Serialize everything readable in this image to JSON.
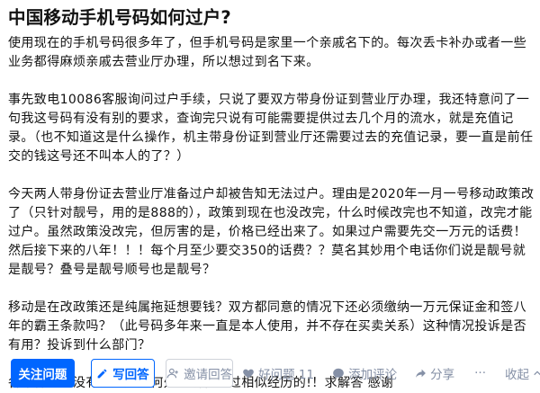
{
  "question": {
    "title": "中国移动手机号码如何过户?",
    "paragraphs": [
      "使用现在的手机号码很多年了，但手机号码是家里一个亲戚名下的。每次丢卡补办或者一些业务都得麻烦亲戚去营业厅办理，所以想过到名下来。",
      "事先致电10086客服询问过户手续，只说了要双方带身份证到营业厅办理，我还特意问了一句我这号码有没有别的要求，查询完只说有可能需要提供过去几个月的流水，就是充值记录。（也不知道这是什么操作，机主带身份证到营业厅还需要过去的充值记录，要一直是前任交的钱这号还不叫本人的了？）",
      "今天两人带身份证去营业厅准备过户却被告知无法过户。理由是2020年一月一号移动政策改了（只针对靓号，用的是888的），政策到现在也没改完，什么时候改完也不知道，改完才能过户。虽然政策没改完，但厉害的是，价格已经出来了。如果过户需要先交一万元的话费！然后接下来的八年！！！每个月至少要交350的话费？？莫名其妙用个电话你们说是靓号就是靓号？叠号是靓号顺号也是靓号？",
      "移动是在改政策还是纯属拖延想要钱？双方都同意的情况下还必须缴纳一万元保证金和签八年的霸王条款吗？（此号码多年来一直是本人使用，并不存在买卖关系）这种情况投诉是否有用？投诉到什么部门？",
      "各路神仙有没有人知道如何处理或者有过相似经历的!！求解答 感谢"
    ]
  },
  "actions": {
    "follow_label": "关注问题",
    "answer_label": "写回答",
    "invite_label": "邀请回答",
    "like_label": "好问题 11",
    "comment_label": "添加评论",
    "share_label": "分享",
    "more_label": "···",
    "collapse_label": "收起"
  },
  "icons": {
    "answer": "pencil-icon",
    "invite": "add-user-icon",
    "like": "heart-icon",
    "comment": "comment-icon",
    "share": "share-icon",
    "collapse": "chevron-up-icon"
  },
  "colors": {
    "primary": "#0066ff",
    "text": "#121212",
    "meta": "#8590a6",
    "gray_border": "#cfd3da"
  }
}
